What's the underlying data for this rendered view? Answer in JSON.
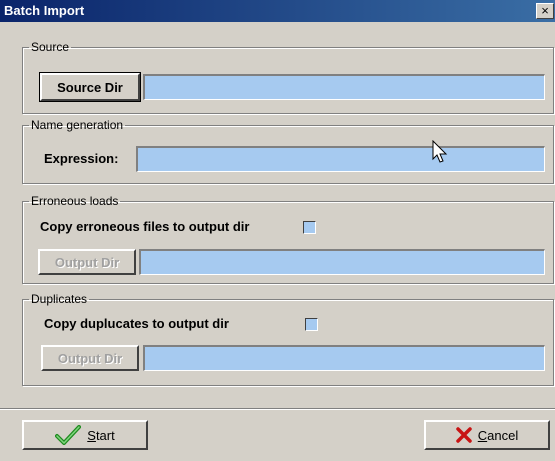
{
  "window": {
    "title": "Batch Import",
    "close_glyph": "×"
  },
  "source": {
    "legend": "Source",
    "button": "Source Dir",
    "value": ""
  },
  "name_generation": {
    "legend": "Name generation",
    "label": "Expression:",
    "value": ""
  },
  "erroneous": {
    "legend": "Erroneous loads",
    "checkbox_label": "Copy erroneous files to output dir",
    "checked": false,
    "button": "Output Dir",
    "value": ""
  },
  "duplicates": {
    "legend": "Duplicates",
    "checkbox_label": "Copy duplucates to output dir",
    "checked": false,
    "button": "Output Dir",
    "value": ""
  },
  "footer": {
    "start_mnemonic": "S",
    "start_rest": "tart",
    "cancel_mnemonic": "C",
    "cancel_rest": "ancel"
  },
  "icons": {
    "start": "checkmark-icon",
    "cancel": "x-icon",
    "pointer": "mouse-cursor-icon"
  },
  "colors": {
    "field_bg": "#a6caf0",
    "title_start": "#0a246a",
    "title_end": "#3a6ea5",
    "face": "#d4d0c8"
  }
}
